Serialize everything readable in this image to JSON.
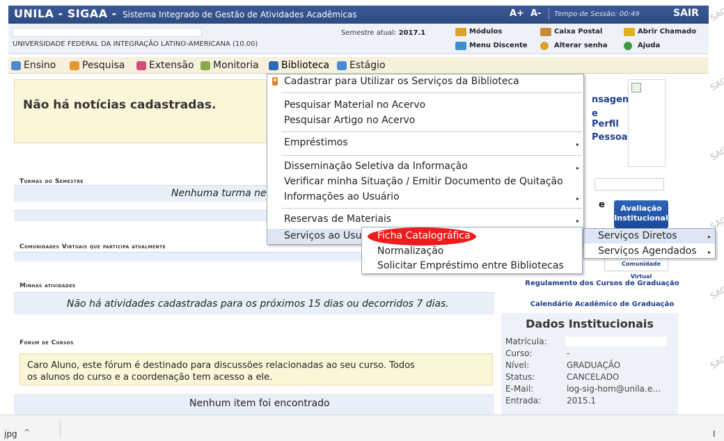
{
  "header": {
    "brand": "UNILA - SIGAA -",
    "subtitle": "Sistema Integrado de Gestão de Atividades Acadêmicas",
    "font_increase": "A+",
    "font_decrease": "A-",
    "session_time": "Tempo de Sessão: 00:49",
    "logout": "SAIR"
  },
  "info": {
    "university": "UNIVERSIDADE FEDERAL DA INTEGRAÇÃO LATINO-AMERICANA (10.00)",
    "semester_label": "Semestre atual:",
    "semester_value": "2017.1",
    "links": {
      "modulos": "Módulos",
      "caixa_postal": "Caixa Postal",
      "abrir_chamado": "Abrir Chamado",
      "menu_discente": "Menu Discente",
      "alterar_senha": "Alterar senha",
      "ajuda": "Ajuda"
    }
  },
  "menu": {
    "ensino": "Ensino",
    "pesquisa": "Pesquisa",
    "extensao": "Extensão",
    "monitoria": "Monitoria",
    "biblioteca": "Biblioteca",
    "estagio": "Estágio"
  },
  "main": {
    "news_empty": "Não há notícias cadastradas.",
    "turmas_title": "Turmas do Semestre",
    "turmas_empty": "Nenhuma turma ne",
    "comunidades_title": "Comunidades Virtuais que participa atualmente",
    "atividades_title": "Minhas atividades",
    "atividades_empty": "Não há atividades cadastradas para os próximos 15 dias ou decorridos 7 dias.",
    "forum_title": "Forum de Cursos",
    "forum_text_line1": "Caro Aluno, este fórum é destinado para discussões relacionadas ao seu curso. Todos",
    "forum_text_line2": "os alunos do curso e a coordenação tem acesso a ele.",
    "forum_empty": "Nenhum item foi encontrado"
  },
  "right_panel": {
    "link_mensagens": "nsagens",
    "link_perfil": "e Perfil",
    "link_pessoais": "Pessoais",
    "letter_e": "e",
    "avaliacao_line1": "Avaliação",
    "avaliacao_line2": "Institucional",
    "comunidade_virtual": "Comunidade Virtual",
    "regulamento": "Regulamento dos Cursos de Graduação",
    "calendario": "Calendário Acadêmico de Graduação",
    "dados_title": "Dados Institucionais",
    "dados": [
      {
        "label": "Matrícula:",
        "value": ""
      },
      {
        "label": "Curso:",
        "value": "-"
      },
      {
        "label": "Nível:",
        "value": "GRADUAÇÃO"
      },
      {
        "label": "Status:",
        "value": "CANCELADO"
      },
      {
        "label": "E-Mail:",
        "value": "log-sig-hom@unila.e..."
      },
      {
        "label": "Entrada:",
        "value": "2015.1"
      }
    ]
  },
  "dropdown": {
    "items": [
      "Cadastrar para Utilizar os Serviços da Biblioteca",
      "Pesquisar Material no Acervo",
      "Pesquisar Artigo no Acervo",
      "Empréstimos",
      "Disseminação Seletiva da Informação",
      "Verificar minha Situação / Emitir Documento de Quitação",
      "Informações ao Usuário",
      "Reservas de Materiais",
      "Serviços ao Usu"
    ]
  },
  "submenu_servicos": {
    "diretos": "Serviços Diretos",
    "agendados": "Serviços Agendados"
  },
  "submenu_diretos": {
    "ficha": "Ficha Catalográfica",
    "normalizacao": "Normalização",
    "emprestimo": "Solicitar Empréstimo entre Bibliotecas"
  },
  "download_bar": {
    "file": "jpg",
    "chevron": "^",
    "right_fragment": "I"
  },
  "watermark": "SAC",
  "colors": {
    "header_blue": "#2c4a82",
    "highlight_red": "#ee1c1c",
    "menu_bg": "#f6f0dc",
    "link_blue": "#1f3d8a"
  }
}
